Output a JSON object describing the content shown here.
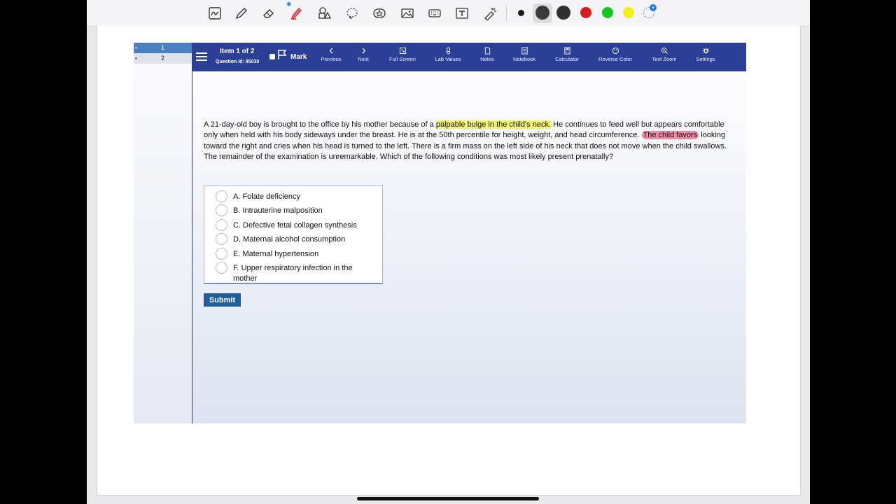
{
  "toolbar": {
    "tools": [
      "lasso-text-icon",
      "pen-icon",
      "eraser-icon",
      "highlighter-icon",
      "shapes-icon",
      "lasso-icon",
      "sticker-icon",
      "image-icon",
      "keyboard-icon",
      "text-box-icon",
      "laser-pointer-icon"
    ],
    "colors": [
      "#1a1a1a",
      "#3a3a3a",
      "#2f2f2f",
      "#d51f1f",
      "#15c61d",
      "#f2ee1e"
    ]
  },
  "exam": {
    "question_list": [
      {
        "number": "1",
        "state": "active"
      },
      {
        "number": "2",
        "state": "inactive"
      }
    ],
    "item_title": "Item 1 of 2",
    "question_id": "Question Id: 95039",
    "mark_label": "Mark",
    "nav": {
      "previous": "Previous",
      "next": "Next",
      "full_screen": "Full Screen",
      "lab_values": "Lab Values",
      "notes": "Notes",
      "notebook": "Notebook",
      "calculator": "Calculator",
      "reverse_color": "Reverse Color",
      "text_zoom": "Text Zoom",
      "settings": "Settings"
    },
    "question": {
      "t1": "A 21-day-old boy is brought to the office by his mother because of a ",
      "hl1": "palpable bulge in the child's neck.",
      "t2": "  He continues to feed well but appears comfortable only when held with his body sideways under the breast.  He is at the 50th percentile for height, weight, and head circumference. ",
      "hl2": "The child favors",
      "t3": " looking toward the right and cries when his head is turned to the left.  There is a firm mass on the left side of his neck that does not move when the child swallows.  The remainder of the examination is unremarkable.  Which of the following conditions was most likely present prenatally?"
    },
    "choices": [
      "A. Folate deficiency",
      "B. Intrauterine malposition",
      "C. Defective fetal collagen synthesis",
      "D. Maternal alcohol consumption",
      "E. Maternal hypertension",
      "F. Upper respiratory infection in the mother"
    ],
    "submit_label": "Submit",
    "highlight_colors": {
      "yellow": "#f2f471",
      "red": "#ee8aa3"
    },
    "header_color": "#2b3f96"
  }
}
